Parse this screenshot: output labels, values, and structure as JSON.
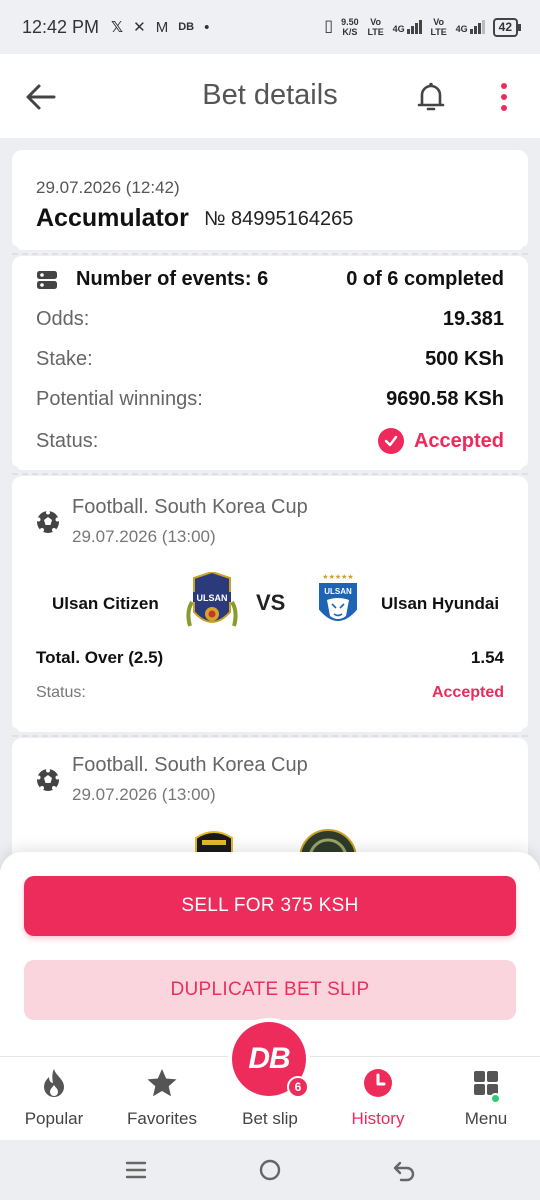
{
  "status_bar": {
    "time": "12:42 PM",
    "net_speed": "9.50",
    "net_unit": "K/S",
    "sim1": "Vo LTE",
    "sim1_tech": "4G",
    "sim2": "Vo LTE",
    "sim2_tech": "4G",
    "battery": "42"
  },
  "header": {
    "title": "Bet details"
  },
  "bet": {
    "date": "29.07.2026 (12:42)",
    "type": "Accumulator",
    "number": "№ 84995164265",
    "events_label": "Number of events: 6",
    "completed": "0 of 6 completed",
    "odds_label": "Odds:",
    "odds_value": "19.381",
    "stake_label": "Stake:",
    "stake_value": "500 KSh",
    "winnings_label": "Potential winnings:",
    "winnings_value": "9690.58 KSh",
    "status_label": "Status:",
    "status_value": "Accepted"
  },
  "events": [
    {
      "league": "Football. South Korea Cup",
      "date": "29.07.2026 (13:00)",
      "home": "Ulsan Citizen",
      "away": "Ulsan Hyundai",
      "vs": "VS",
      "market": "Total. Over (2.5)",
      "odds": "1.54",
      "status_label": "Status:",
      "status_value": "Accepted",
      "home_crest_text": "ULSAN",
      "away_crest_text": "ULSAN"
    },
    {
      "league": "Football. South Korea Cup",
      "date": "29.07.2026 (13:00)"
    }
  ],
  "actions": {
    "sell": "SELL FOR 375 KSH",
    "duplicate": "DUPLICATE BET SLIP"
  },
  "bottom_nav": {
    "items": [
      {
        "label": "Popular",
        "icon": "flame-icon"
      },
      {
        "label": "Favorites",
        "icon": "star-icon"
      },
      {
        "label": "Bet slip",
        "icon": "db-logo"
      },
      {
        "label": "History",
        "icon": "clock-icon"
      },
      {
        "label": "Menu",
        "icon": "grid-icon"
      }
    ],
    "logo_text": "DB",
    "bet_slip_count": "6"
  },
  "colors": {
    "accent": "#ee2c5c",
    "accent_light": "#fbd5de",
    "success_dot": "#2ecc71"
  }
}
